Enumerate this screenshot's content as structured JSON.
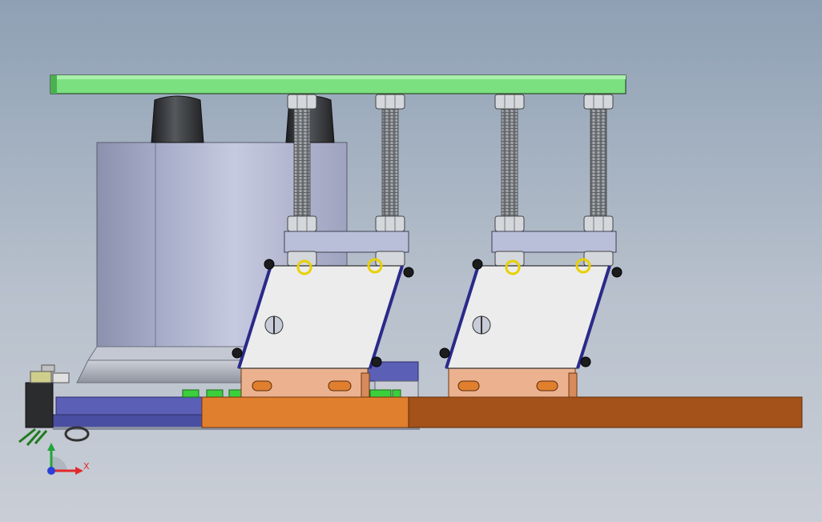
{
  "colors": {
    "background_top": "#8ea0b4",
    "background_bottom": "#c9ced6",
    "top_plate": "#7be07f",
    "cylinder_body": "#aeb4d0",
    "copper_busbar_light": "#e07f2e",
    "copper_busbar_dark": "#a4521a",
    "contact_pad": "#ecb28f",
    "bracket_plate": "#ececec",
    "clamp_bar": "#b9bfd8",
    "base_blue": "#5b5fb6",
    "threaded_rod": "#8f9397",
    "hex_nut": "#cfd2d6",
    "x_axis": "#e02a2a",
    "y_axis": "#22a43a",
    "z_axis": "#2a3fd8"
  },
  "triad": {
    "x_label": "X",
    "y_label": "",
    "z_label": ""
  }
}
